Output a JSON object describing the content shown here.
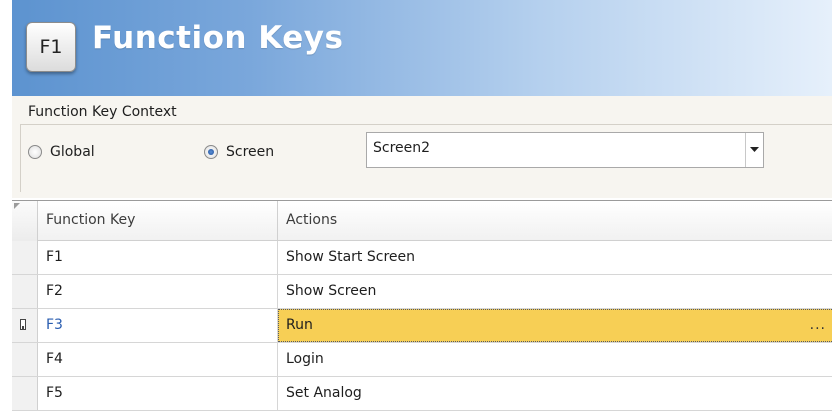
{
  "header": {
    "key_icon_label": "F1",
    "title": "Function Keys"
  },
  "context": {
    "group_title": "Function Key Context",
    "options": [
      {
        "label": "Global",
        "checked": false
      },
      {
        "label": "Screen",
        "checked": true
      }
    ],
    "screen_dropdown": {
      "selected": "Screen2"
    }
  },
  "grid": {
    "columns": [
      "Function Key",
      "Actions"
    ],
    "rows": [
      {
        "key": "F1",
        "action": "Show Start Screen",
        "selected": false
      },
      {
        "key": "F2",
        "action": "Show Screen",
        "selected": false
      },
      {
        "key": "F3",
        "action": "Run",
        "selected": true,
        "ellipsis": "..."
      },
      {
        "key": "F4",
        "action": "Login",
        "selected": false
      },
      {
        "key": "F5",
        "action": "Set Analog",
        "selected": false
      }
    ]
  },
  "colors": {
    "header_blue": "#5b92cf",
    "selected_cell": "#f7cf55",
    "selected_key_text": "#2a5db0"
  }
}
